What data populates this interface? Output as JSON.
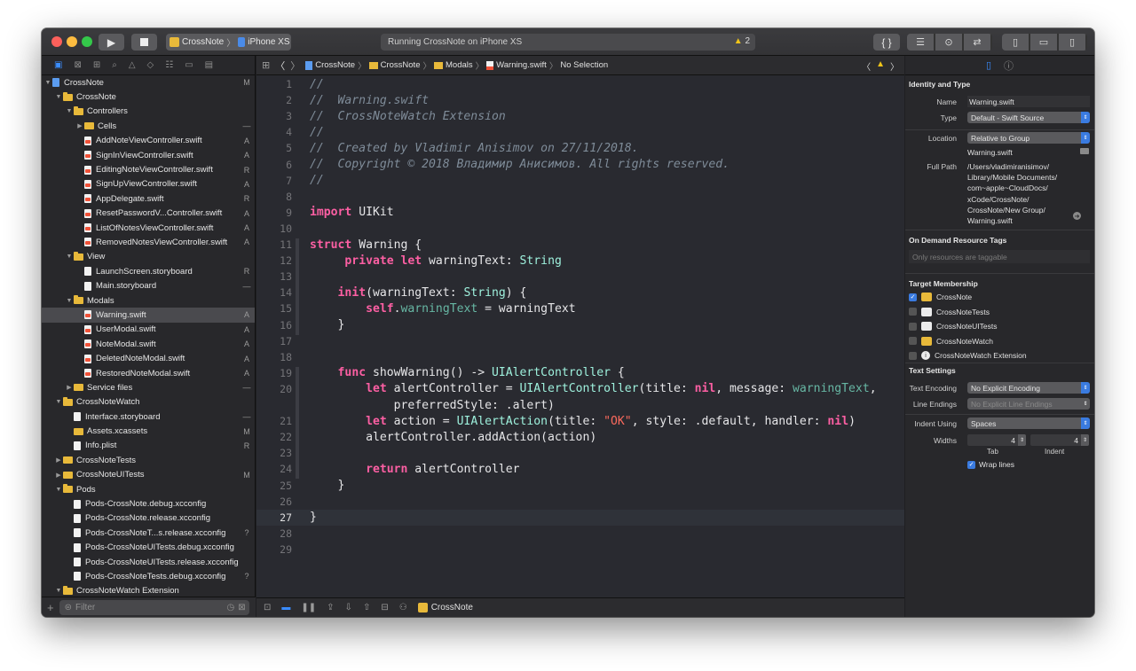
{
  "toolbar": {
    "scheme_name": "CrossNote",
    "device_name": "iPhone XS",
    "status_text": "Running CrossNote on iPhone XS",
    "warning_count": "2",
    "braces_label": "{ }"
  },
  "navigator": {
    "filter_placeholder": "Filter",
    "rows": [
      {
        "name": "CrossNote",
        "status": "M",
        "indent": 0,
        "tri": "▼",
        "kind": "proj"
      },
      {
        "name": "CrossNote",
        "status": "",
        "indent": 1,
        "tri": "▼",
        "kind": "folder"
      },
      {
        "name": "Controllers",
        "status": "",
        "indent": 2,
        "tri": "▼",
        "kind": "folder"
      },
      {
        "name": "Cells",
        "status": "—",
        "indent": 3,
        "tri": "▶",
        "kind": "folder-closed"
      },
      {
        "name": "AddNoteViewController.swift",
        "status": "A",
        "indent": 3,
        "tri": "",
        "kind": "swift"
      },
      {
        "name": "SignInViewController.swift",
        "status": "A",
        "indent": 3,
        "tri": "",
        "kind": "swift"
      },
      {
        "name": "EditingNoteViewController.swift",
        "status": "R",
        "indent": 3,
        "tri": "",
        "kind": "swift"
      },
      {
        "name": "SignUpViewController.swift",
        "status": "A",
        "indent": 3,
        "tri": "",
        "kind": "swift"
      },
      {
        "name": "AppDelegate.swift",
        "status": "R",
        "indent": 3,
        "tri": "",
        "kind": "swift"
      },
      {
        "name": "ResetPasswordV...Controller.swift",
        "status": "A",
        "indent": 3,
        "tri": "",
        "kind": "swift"
      },
      {
        "name": "ListOfNotesViewController.swift",
        "status": "A",
        "indent": 3,
        "tri": "",
        "kind": "swift"
      },
      {
        "name": "RemovedNotesViewController.swift",
        "status": "A",
        "indent": 3,
        "tri": "",
        "kind": "swift"
      },
      {
        "name": "View",
        "status": "",
        "indent": 2,
        "tri": "▼",
        "kind": "folder"
      },
      {
        "name": "LaunchScreen.storyboard",
        "status": "R",
        "indent": 3,
        "tri": "",
        "kind": "file"
      },
      {
        "name": "Main.storyboard",
        "status": "—",
        "indent": 3,
        "tri": "",
        "kind": "file"
      },
      {
        "name": "Modals",
        "status": "",
        "indent": 2,
        "tri": "▼",
        "kind": "folder"
      },
      {
        "name": "Warning.swift",
        "status": "A",
        "indent": 3,
        "tri": "",
        "kind": "swift",
        "selected": true
      },
      {
        "name": "UserModal.swift",
        "status": "A",
        "indent": 3,
        "tri": "",
        "kind": "swift"
      },
      {
        "name": "NoteModal.swift",
        "status": "A",
        "indent": 3,
        "tri": "",
        "kind": "swift"
      },
      {
        "name": "DeletedNoteModal.swift",
        "status": "A",
        "indent": 3,
        "tri": "",
        "kind": "swift"
      },
      {
        "name": "RestoredNoteModal.swift",
        "status": "A",
        "indent": 3,
        "tri": "",
        "kind": "swift"
      },
      {
        "name": "Service files",
        "status": "—",
        "indent": 2,
        "tri": "▶",
        "kind": "folder-closed"
      },
      {
        "name": "CrossNoteWatch",
        "status": "",
        "indent": 1,
        "tri": "▼",
        "kind": "folder"
      },
      {
        "name": "Interface.storyboard",
        "status": "—",
        "indent": 2,
        "tri": "",
        "kind": "file"
      },
      {
        "name": "Assets.xcassets",
        "status": "M",
        "indent": 2,
        "tri": "",
        "kind": "folder-closed"
      },
      {
        "name": "Info.plist",
        "status": "R",
        "indent": 2,
        "tri": "",
        "kind": "file"
      },
      {
        "name": "CrossNoteTests",
        "status": "",
        "indent": 1,
        "tri": "▶",
        "kind": "folder-closed"
      },
      {
        "name": "CrossNoteUITests",
        "status": "M",
        "indent": 1,
        "tri": "▶",
        "kind": "folder-closed"
      },
      {
        "name": "Pods",
        "status": "",
        "indent": 1,
        "tri": "▼",
        "kind": "folder"
      },
      {
        "name": "Pods-CrossNote.debug.xcconfig",
        "status": "",
        "indent": 2,
        "tri": "",
        "kind": "file"
      },
      {
        "name": "Pods-CrossNote.release.xcconfig",
        "status": "",
        "indent": 2,
        "tri": "",
        "kind": "file"
      },
      {
        "name": "Pods-CrossNoteT...s.release.xcconfig",
        "status": "?",
        "indent": 2,
        "tri": "",
        "kind": "file"
      },
      {
        "name": "Pods-CrossNoteUITests.debug.xcconfig",
        "status": "",
        "indent": 2,
        "tri": "",
        "kind": "file"
      },
      {
        "name": "Pods-CrossNoteUITests.release.xcconfig",
        "status": "",
        "indent": 2,
        "tri": "",
        "kind": "file"
      },
      {
        "name": "Pods-CrossNoteTests.debug.xcconfig",
        "status": "?",
        "indent": 2,
        "tri": "",
        "kind": "file"
      },
      {
        "name": "CrossNoteWatch Extension",
        "status": "",
        "indent": 1,
        "tri": "▼",
        "kind": "folder"
      }
    ]
  },
  "jumpbar": {
    "crumbs": [
      "CrossNote",
      "CrossNote",
      "Modals",
      "Warning.swift",
      "No Selection"
    ]
  },
  "editor": {
    "lines": [
      {
        "n": "1",
        "html": "<span class='c-com'>//</span>"
      },
      {
        "n": "2",
        "html": "<span class='c-com'>//  Warning.swift</span>"
      },
      {
        "n": "3",
        "html": "<span class='c-com'>//  CrossNoteWatch Extension</span>"
      },
      {
        "n": "4",
        "html": "<span class='c-com'>//</span>"
      },
      {
        "n": "5",
        "html": "<span class='c-com'>//  Created by Vladimir Anisimov on 27/11/2018.</span>"
      },
      {
        "n": "6",
        "html": "<span class='c-com'>//  Copyright © 2018 Владимир Анисимов. All rights reserved.</span>"
      },
      {
        "n": "7",
        "html": "<span class='c-com'>//</span>"
      },
      {
        "n": "8",
        "html": ""
      },
      {
        "n": "9",
        "html": "<span class='c-kw'>import</span> UIKit"
      },
      {
        "n": "10",
        "html": ""
      },
      {
        "n": "11",
        "html": "<span class='c-kw'>struct</span> Warning {"
      },
      {
        "n": "12",
        "html": "     <span class='c-kw'>private</span> <span class='c-kw'>let</span> warningText: <span class='c-tyg'>String</span>"
      },
      {
        "n": "13",
        "html": ""
      },
      {
        "n": "14",
        "html": "    <span class='c-kw'>init</span>(warningText: <span class='c-tyg'>String</span>) {"
      },
      {
        "n": "15",
        "html": "        <span class='c-kw'>self</span>.<span class='c-id'>warningText</span> = warningText"
      },
      {
        "n": "16",
        "html": "    }"
      },
      {
        "n": "17",
        "html": ""
      },
      {
        "n": "18",
        "html": ""
      },
      {
        "n": "19",
        "html": "    <span class='c-kw'>func</span> showWarning() -> <span class='c-tyg'>UIAlertController</span> {"
      },
      {
        "n": "20",
        "html": "        <span class='c-kw'>let</span> alertController = <span class='c-tyg'>UIAlertController</span>(title: <span class='c-kw'>nil</span>, message: <span class='c-id'>warningText</span>,"
      },
      {
        "n": "",
        "html": "            preferredStyle: .alert)"
      },
      {
        "n": "21",
        "html": "        <span class='c-kw'>let</span> action = <span class='c-tyg'>UIAlertAction</span>(title: <span class='c-str'>\"OK\"</span>, style: .default, handler: <span class='c-kw'>nil</span>)"
      },
      {
        "n": "22",
        "html": "        alertController.addAction(action)"
      },
      {
        "n": "23",
        "html": ""
      },
      {
        "n": "24",
        "html": "        <span class='c-kw'>return</span> alertController"
      },
      {
        "n": "25",
        "html": "    }"
      },
      {
        "n": "26",
        "html": ""
      },
      {
        "n": "27",
        "html": "}",
        "current": true
      },
      {
        "n": "28",
        "html": ""
      },
      {
        "n": "29",
        "html": ""
      }
    ]
  },
  "debug": {
    "target": "CrossNote"
  },
  "inspector": {
    "identity_title": "Identity and Type",
    "name_label": "Name",
    "name_value": "Warning.swift",
    "type_label": "Type",
    "type_value": "Default - Swift Source",
    "location_label": "Location",
    "location_value": "Relative to Group",
    "location_file": "Warning.swift",
    "fullpath_label": "Full Path",
    "fullpath_lines": [
      "/Users/vladimiranisimov/",
      "Library/Mobile Documents/",
      "com~apple~CloudDocs/",
      "xCode/CrossNote/",
      "CrossNote/New Group/",
      "Warning.swift"
    ],
    "odr_title": "On Demand Resource Tags",
    "odr_placeholder": "Only resources are taggable",
    "tm_title": "Target Membership",
    "targets": [
      {
        "name": "CrossNote",
        "checked": true,
        "icon": "app"
      },
      {
        "name": "CrossNoteTests",
        "checked": false,
        "icon": "white"
      },
      {
        "name": "CrossNoteUITests",
        "checked": false,
        "icon": "white"
      },
      {
        "name": "CrossNoteWatch",
        "checked": false,
        "icon": "app"
      },
      {
        "name": "CrossNoteWatch Extension",
        "checked": false,
        "icon": "info"
      }
    ],
    "ts_title": "Text Settings",
    "enc_label": "Text Encoding",
    "enc_value": "No Explicit Encoding",
    "le_label": "Line Endings",
    "le_value": "No Explicit Line Endings",
    "indent_label": "Indent Using",
    "indent_value": "Spaces",
    "widths_label": "Widths",
    "tab_value": "4",
    "indent_width_value": "4",
    "tab_caption": "Tab",
    "indent_caption": "Indent",
    "wrap_label": "Wrap lines"
  }
}
